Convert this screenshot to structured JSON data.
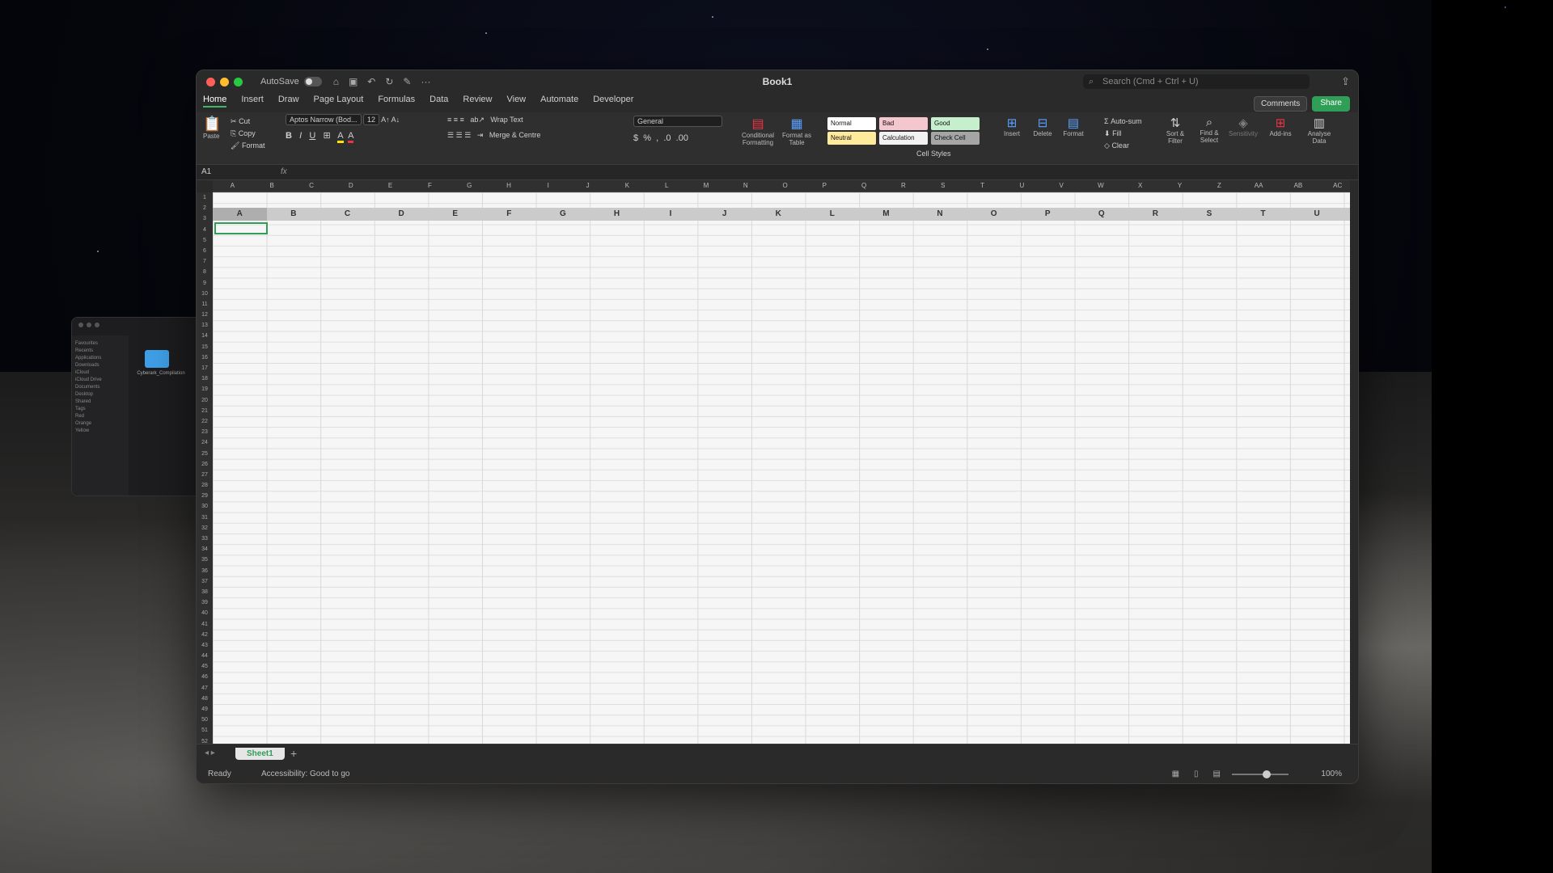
{
  "window": {
    "title": "Book1"
  },
  "titlebar": {
    "autosave_label": "AutoSave",
    "search_placeholder": "Search (Cmd + Ctrl + U)"
  },
  "tabs": [
    "Home",
    "Insert",
    "Draw",
    "Page Layout",
    "Formulas",
    "Data",
    "Review",
    "View",
    "Automate",
    "Developer"
  ],
  "active_tab": "Home",
  "header_buttons": {
    "comments": "Comments",
    "share": "Share"
  },
  "ribbon": {
    "paste": "Paste",
    "cut": "Cut",
    "copy": "Copy",
    "format": "Format",
    "font_name": "Aptos Narrow (Bod...",
    "font_size": "12",
    "wrap_text": "Wrap Text",
    "merge_centre": "Merge & Centre",
    "number_format": "General",
    "conditional_formatting": "Conditional Formatting",
    "format_as_table": "Format as Table",
    "styles": [
      {
        "label": "Normal",
        "color": "#ffffff"
      },
      {
        "label": "Bad",
        "color": "#f4c7ce"
      },
      {
        "label": "Good",
        "color": "#c6efce"
      },
      {
        "label": "Neutral",
        "color": "#ffeb9c"
      },
      {
        "label": "Calculation",
        "color": "#f2f2f2"
      },
      {
        "label": "Check Cell",
        "color": "#a5a5a5"
      }
    ],
    "cell_styles": "Cell Styles",
    "insert": "Insert",
    "delete": "Delete",
    "format_cells": "Format",
    "autosum": "Auto-sum",
    "fill": "Fill",
    "clear": "Clear",
    "sort_filter": "Sort & Filter",
    "find_select": "Find & Select",
    "sensitivity": "Sensitivity",
    "addins": "Add-ins",
    "analyse_data": "Analyse Data"
  },
  "formula_bar": {
    "name_box": "A1",
    "fx": "fx"
  },
  "columns_small": [
    "A",
    "B",
    "C",
    "D",
    "E",
    "F",
    "G",
    "H",
    "I",
    "J",
    "K",
    "L",
    "M",
    "N",
    "O",
    "P",
    "Q",
    "R",
    "S",
    "T",
    "U",
    "V",
    "W",
    "X",
    "Y",
    "Z",
    "AA",
    "AB",
    "AC"
  ],
  "columns_large": [
    "A",
    "B",
    "C",
    "D",
    "E",
    "F",
    "G",
    "H",
    "I",
    "J",
    "K",
    "L",
    "M",
    "N",
    "O",
    "P",
    "Q",
    "R",
    "S",
    "T",
    "U"
  ],
  "rows": [
    "1",
    "2",
    "3",
    "4",
    "5",
    "6",
    "7",
    "8",
    "9",
    "10",
    "11",
    "12",
    "13",
    "14",
    "15",
    "16",
    "17",
    "18",
    "19",
    "20",
    "21",
    "22",
    "23",
    "24",
    "25",
    "26",
    "27",
    "28",
    "29",
    "30",
    "31",
    "32",
    "33",
    "34",
    "35",
    "36",
    "37",
    "38",
    "39",
    "40",
    "41",
    "42",
    "43",
    "44",
    "45",
    "46",
    "47",
    "48",
    "49",
    "50",
    "51",
    "52"
  ],
  "sheet": {
    "name": "Sheet1",
    "add": "+"
  },
  "status": {
    "ready": "Ready",
    "accessibility": "Accessibility: Good to go",
    "zoom": "100%"
  },
  "finder": {
    "sidebar": [
      "Favourites",
      "Recents",
      "Applications",
      "Downloads",
      "iCloud",
      "iCloud Drive",
      "Documents",
      "Desktop",
      "Shared",
      "Tags",
      "Red",
      "Orange",
      "Yellow"
    ],
    "folder_name": "Cyberark_Compilation"
  }
}
